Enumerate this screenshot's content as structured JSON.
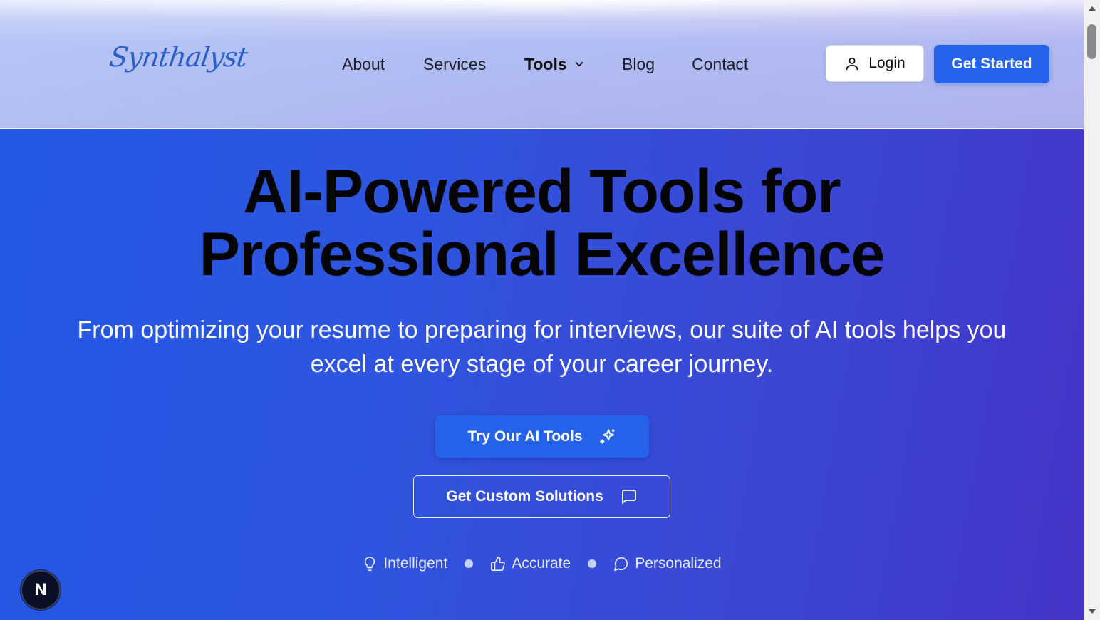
{
  "header": {
    "logo": "Synthalyst",
    "nav": {
      "about": "About",
      "services": "Services",
      "tools": "Tools",
      "blog": "Blog",
      "contact": "Contact"
    },
    "login_label": "Login",
    "get_started_label": "Get Started"
  },
  "hero": {
    "title_line1": "AI-Powered Tools for",
    "title_line2": "Professional Excellence",
    "subtitle_line1": "From optimizing your resume to preparing for interviews, our suite of AI tools helps you",
    "subtitle_line2": "excel at every stage of your career journey.",
    "primary_cta": "Try Our AI Tools",
    "secondary_cta": "Get Custom Solutions",
    "features": [
      "Intelligent",
      "Accurate",
      "Personalized"
    ]
  },
  "badge": {
    "letter": "N"
  },
  "colors": {
    "accent": "#2563eb",
    "hero_start": "#2258e3",
    "hero_end": "#4434c8",
    "title_text": "#050505"
  },
  "icons": {
    "tools_dropdown": "chevron-down-icon",
    "login": "user-icon",
    "try_tools": "sparkles-icon",
    "custom_solutions": "message-square-icon",
    "intelligent": "lightbulb-icon",
    "accurate": "thumbs-up-icon",
    "personalized": "message-circle-icon"
  }
}
